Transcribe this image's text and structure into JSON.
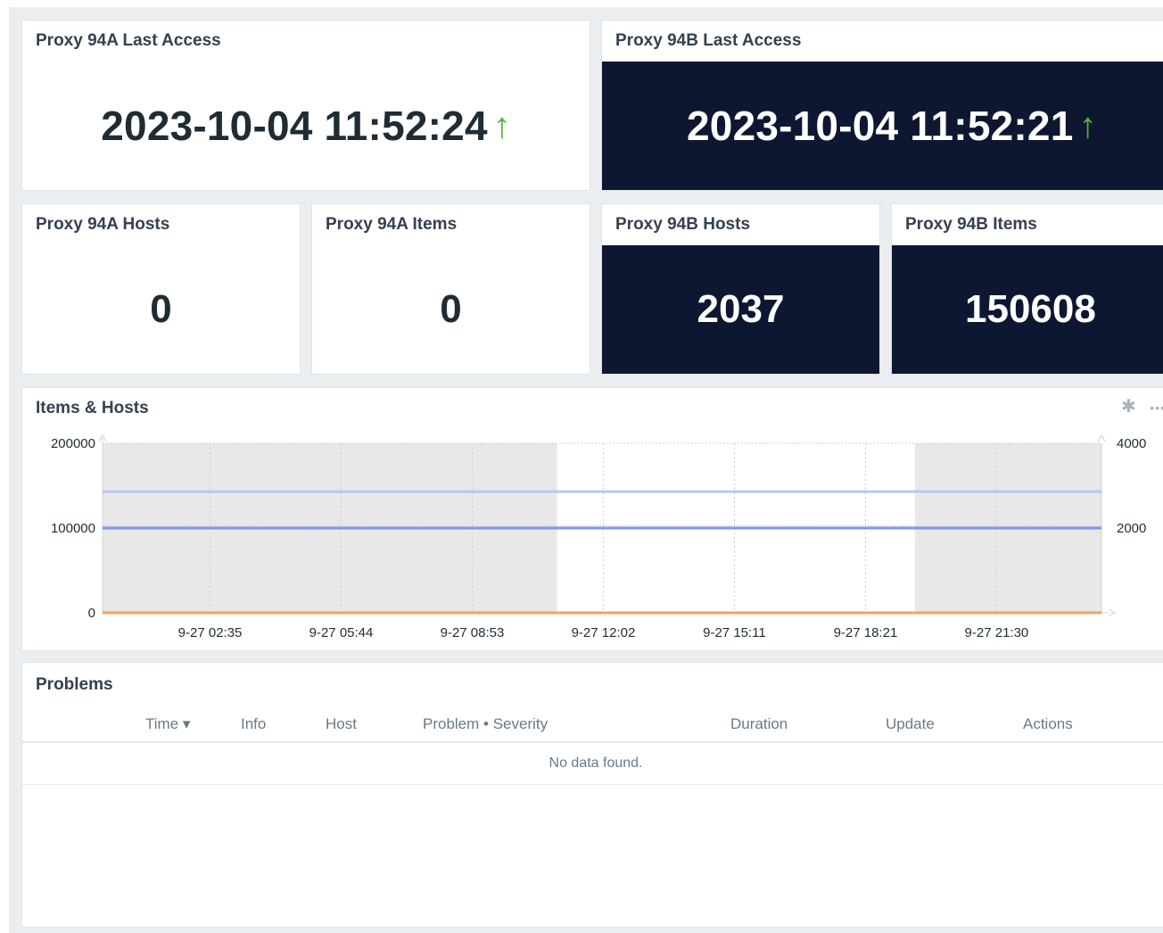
{
  "widgets": {
    "proxy94a_last_access": {
      "title": "Proxy 94A Last Access",
      "value": "2023-10-04 11:52:24",
      "trend_icon": "arrow-up-icon",
      "trend_glyph": "↑"
    },
    "proxy94b_last_access": {
      "title": "Proxy 94B Last Access",
      "value": "2023-10-04 11:52:21",
      "trend_icon": "arrow-up-icon",
      "trend_glyph": "↑"
    },
    "proxy94a_hosts": {
      "title": "Proxy 94A Hosts",
      "value": "0"
    },
    "proxy94a_items": {
      "title": "Proxy 94A Items",
      "value": "0"
    },
    "proxy94b_hosts": {
      "title": "Proxy 94B Hosts",
      "value": "2037"
    },
    "proxy94b_items": {
      "title": "Proxy 94B Items",
      "value": "150608"
    }
  },
  "graph": {
    "title": "Items & Hosts",
    "icons": {
      "settings": "gear-icon",
      "settings_glyph": "✱",
      "more": "more-icon",
      "more_glyph": "•••"
    }
  },
  "chart_data": {
    "type": "line",
    "title": "Items & Hosts",
    "x": [
      "9-27 02:35",
      "9-27 05:44",
      "9-27 08:53",
      "9-27 12:02",
      "9-27 15:11",
      "9-27 18:21",
      "9-27 21:30"
    ],
    "y_left": {
      "ticks": [
        "200000",
        "100000",
        "0"
      ],
      "ylim": [
        0,
        200000
      ]
    },
    "y_right": {
      "ticks": [
        "4000",
        "2000"
      ],
      "ylim": [
        0,
        4000
      ]
    },
    "x_range_hours": [
      0,
      23.3
    ],
    "night_shading": [
      [
        0,
        10.6
      ],
      [
        18.95,
        23.3
      ]
    ],
    "series": [
      {
        "axis": "left",
        "value": 143000,
        "color": "#b7c7f5",
        "style": "solid"
      },
      {
        "axis": "left",
        "value": 100000,
        "color": "#7c95e8",
        "style": "solid"
      },
      {
        "axis": "right",
        "value": 2037,
        "color": "#a9baf1",
        "style": "dotted"
      },
      {
        "axis": "left",
        "value": 0,
        "color": "#f0a35e",
        "style": "solid"
      }
    ],
    "colors": {
      "shading": "#e8e8e8",
      "grid": "#cccccc"
    }
  },
  "problems": {
    "title": "Problems",
    "columns": [
      "Time ▾",
      "Info",
      "Host",
      "Problem • Severity",
      "Duration",
      "Update",
      "Actions"
    ],
    "empty_text": "No data found."
  }
}
